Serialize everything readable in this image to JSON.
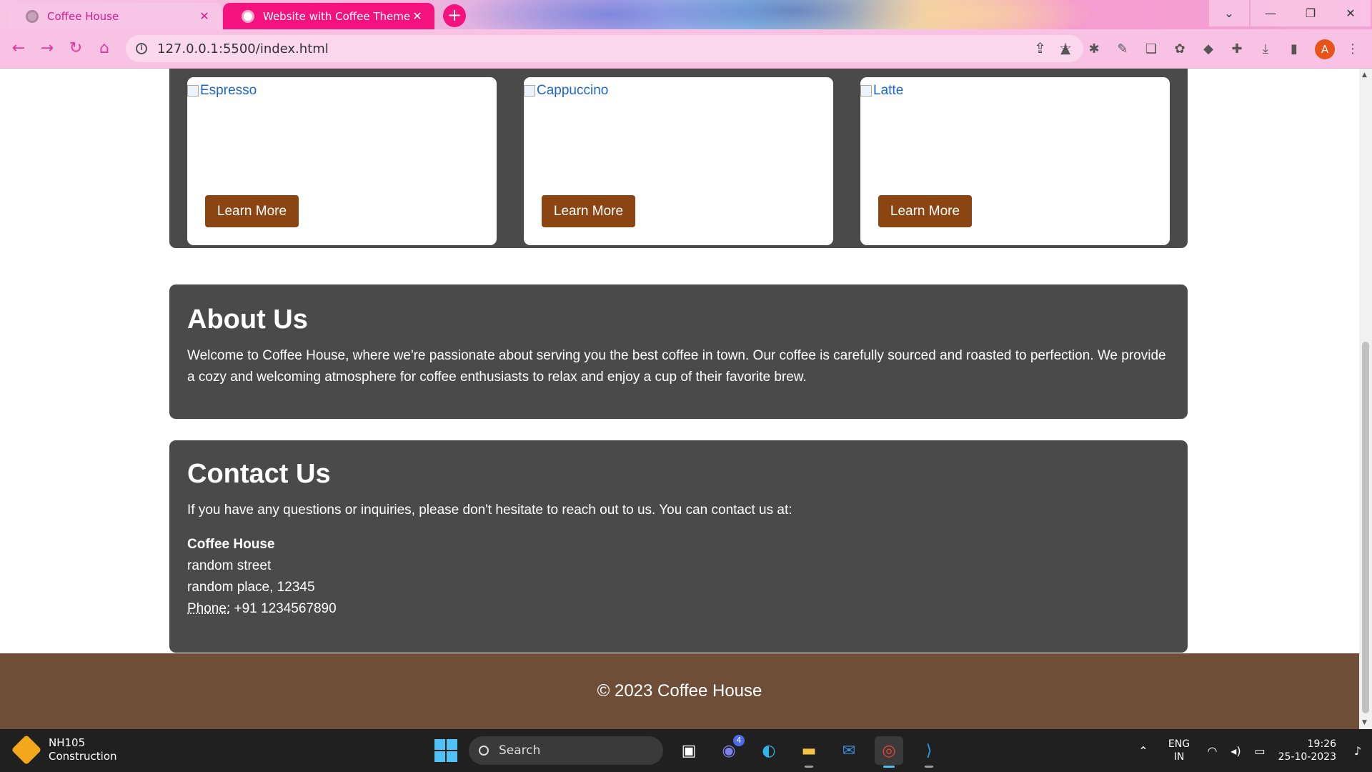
{
  "browser": {
    "tabs": [
      {
        "title": "Coffee House",
        "active": false
      },
      {
        "title": "Website with Coffee Theme",
        "active": true
      }
    ],
    "new_tab_label": "+",
    "url": "127.0.0.1:5500/index.html",
    "profile_initial": "A",
    "window_controls": {
      "tab_search": "⌄",
      "minimize": "—",
      "restore": "❐",
      "close": "✕"
    },
    "nav_icons": {
      "back": "←",
      "forward": "→",
      "reload": "↻",
      "home": "⌂"
    }
  },
  "page": {
    "menu": {
      "items": [
        {
          "alt": "Espresso",
          "button": "Learn More"
        },
        {
          "alt": "Cappuccino",
          "button": "Learn More"
        },
        {
          "alt": "Latte",
          "button": "Learn More"
        }
      ]
    },
    "about": {
      "heading": "About Us",
      "text": "Welcome to Coffee House, where we're passionate about serving you the best coffee in town. Our coffee is carefully sourced and roasted to perfection. We provide a cozy and welcoming atmosphere for coffee enthusiasts to relax and enjoy a cup of their favorite brew."
    },
    "contact": {
      "heading": "Contact Us",
      "intro": "If you have any questions or inquiries, please don't hesitate to reach out to us. You can contact us at:",
      "name": "Coffee House",
      "street": "random street",
      "place": "random place, 12345",
      "phone_label": "Phone:",
      "phone": "+91 1234567890"
    },
    "footer": "© 2023 Coffee House"
  },
  "taskbar": {
    "weather_title": "NH105",
    "weather_sub": "Construction",
    "search_label": "Search",
    "lang_top": "ENG",
    "lang_bottom": "IN",
    "time": "19:26",
    "date": "25-10-2023",
    "badge_count": "4"
  },
  "colors": {
    "section_bg": "#4a4a4a",
    "button_bg": "#8b4513",
    "footer_bg": "#6f4e37",
    "tab_active": "#f4127f"
  }
}
